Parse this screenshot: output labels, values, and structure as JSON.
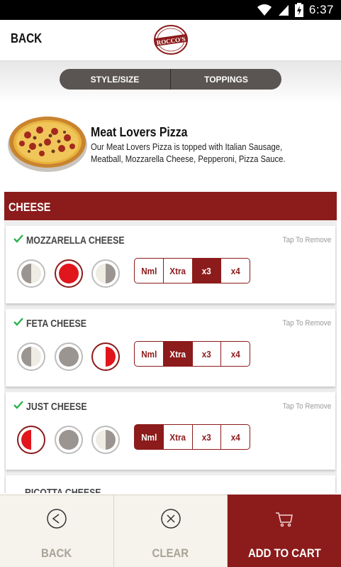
{
  "status_bar": {
    "time": "6:37",
    "battery_level": "charging"
  },
  "header": {
    "back_label": "BACK",
    "logo_text": "ROCCO'S"
  },
  "tabs": [
    {
      "label": "STYLE/SIZE"
    },
    {
      "label": "TOPPINGS"
    }
  ],
  "product": {
    "title": "Meat Lovers Pizza",
    "description": "Our Meat Lovers Pizza is topped with Italian Sausage, Meatball, Mozzarella Cheese, Pepperoni, Pizza Sauce."
  },
  "section": {
    "title": "CHEESE"
  },
  "remove_label": "Tap To Remove",
  "amount_options": [
    "Nml",
    "Xtra",
    "x3",
    "x4"
  ],
  "toppings": [
    {
      "name": "MOZZARELLA CHEESE",
      "selected_half": "whole",
      "selected_amount": "x3"
    },
    {
      "name": "FETA CHEESE",
      "selected_half": "right",
      "selected_amount": "Xtra"
    },
    {
      "name": "JUST CHEESE",
      "selected_half": "left",
      "selected_amount": "Nml"
    }
  ],
  "partial_topping": "RICOTTA CHEESE",
  "bottom_bar": {
    "back_label": "BACK",
    "clear_label": "CLEAR",
    "add_to_cart_label": "ADD TO CART"
  },
  "colors": {
    "accent": "#8c1b1b",
    "selection_red": "#e0161c",
    "button_bg": "#f6f3ec",
    "toggle_bg": "#5a5552"
  }
}
